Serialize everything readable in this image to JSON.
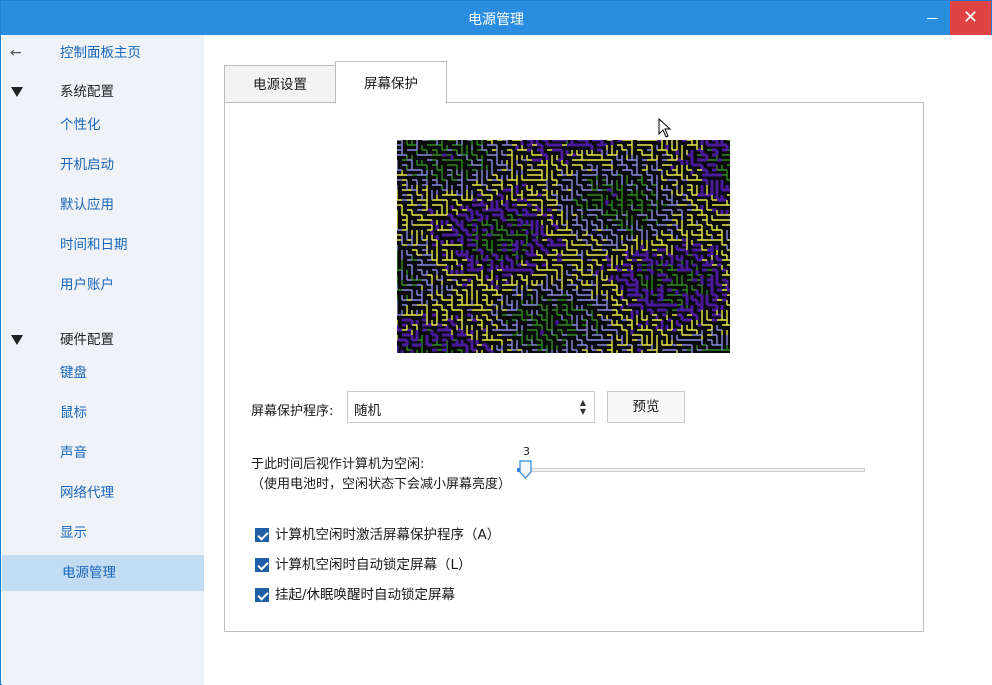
{
  "window": {
    "title": "电源管理",
    "minimize_glyph": "—",
    "close_glyph": "✕"
  },
  "sidebar": {
    "home": "控制面板主页",
    "sections": [
      {
        "title": "系统配置",
        "items": [
          "个性化",
          "开机启动",
          "默认应用",
          "时间和日期",
          "用户账户"
        ]
      },
      {
        "title": "硬件配置",
        "items": [
          "键盘",
          "鼠标",
          "声音",
          "网络代理",
          "显示",
          "电源管理"
        ]
      }
    ],
    "active_item": "电源管理"
  },
  "tabs": [
    {
      "label": "电源设置"
    },
    {
      "label": "屏幕保护"
    }
  ],
  "active_tab": "屏幕保护",
  "screensaver": {
    "program_label": "屏幕保护程序:",
    "program_value": "随机",
    "preview_button": "预览",
    "idle_label": "于此时间后视作计算机为空闲:",
    "idle_note": "（使用电池时，空闲状态下会减小屏幕亮度）",
    "slider_value": "3",
    "checkboxes": [
      {
        "label": "计算机空闲时激活屏幕保护程序（A）",
        "checked": true
      },
      {
        "label": "计算机空闲时自动锁定屏幕（L）",
        "checked": true
      },
      {
        "label": "挂起/休眠唤醒时自动锁定屏幕",
        "checked": true
      }
    ]
  },
  "colors": {
    "titlebar": "#2b8de0",
    "close_button": "#e04343",
    "sidebar_bg": "#eff3f7",
    "sidebar_active": "#c1dcf3",
    "link": "#1a66b8",
    "maze": [
      "#2e8b1e",
      "#4a1a9c",
      "#e8e84a",
      "#8a8ae0"
    ]
  }
}
